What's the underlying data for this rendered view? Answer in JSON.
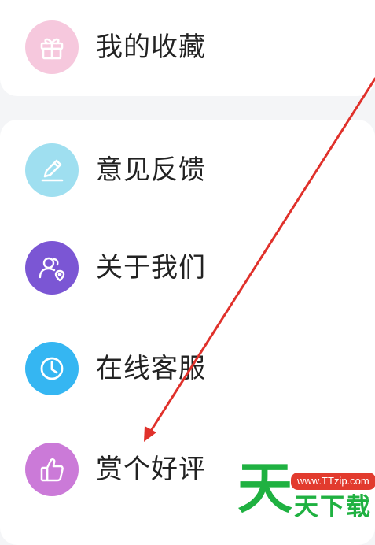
{
  "menu": {
    "items": [
      {
        "label": "我的收藏",
        "icon": "gift-icon",
        "color": "#f6c8dd"
      },
      {
        "label": "意见反馈",
        "icon": "pencil-icon",
        "color": "#9fdff0"
      },
      {
        "label": "关于我们",
        "icon": "users-location-icon",
        "color": "#7b56d4"
      },
      {
        "label": "在线客服",
        "icon": "clock-icon",
        "color": "#35b6f2"
      },
      {
        "label": "赏个好评",
        "icon": "thumbs-up-icon",
        "color": "#cb7ad8"
      }
    ]
  },
  "annotation": {
    "arrow_color": "#e0312b"
  },
  "watermark": {
    "big_char": "天",
    "url": "www.TTzip.com",
    "text": "天下载"
  }
}
